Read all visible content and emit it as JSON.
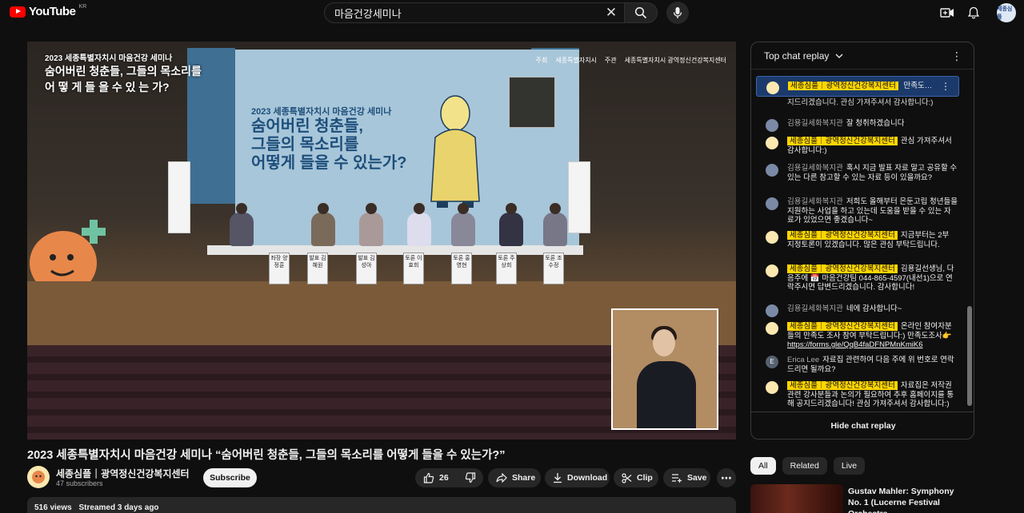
{
  "header": {
    "logo_text": "YouTube",
    "country": "KR",
    "search_value": "마음건강세미나",
    "avatar_text": "세종심플"
  },
  "video": {
    "overlay_line1": "2023 세종특별자치시 마음건강 세미나",
    "overlay_line2": "숨어버린 청춘들, 그들의 목소리를",
    "overlay_line3": "어 떻 게  들 을  수  있 는 가?",
    "sponsor1_role": "주최",
    "sponsor1_name": "세종특별자치시",
    "sponsor2_role": "주관",
    "sponsor2_name": "세종특별자치시 광역정신건강복지센터",
    "screen_sub": "2023 세종특별자치시 마음건강 세미나",
    "screen_l1": "숨어버린 청춘들,",
    "screen_l2": "그들의 목소리를",
    "screen_l3": "어떻게 들을 수 있는가?",
    "nameplates": [
      "좌장 양정훈",
      "발표 김혜원",
      "발표 김성아",
      "토론 이효희",
      "토론 홍영현",
      "토론 주상희",
      "토론 조수정"
    ]
  },
  "title": "2023 세종특별자치시 마음건강 세미나 “숨어버린 청춘들, 그들의 목소리를 어떻게 들을 수 있는가?”",
  "channel": {
    "name": "세종심플｜광역정신건강복지센터",
    "subscribers": "47 subscribers",
    "subscribe_label": "Subscribe"
  },
  "actions": {
    "likes": "26",
    "share": "Share",
    "download": "Download",
    "clip": "Clip",
    "save": "Save"
  },
  "description": {
    "views": "516 views",
    "streamed": "Streamed 3 days ago"
  },
  "chat": {
    "header": "Top chat replay",
    "pinned_author": "세종심플｜광역정신건강복지센터",
    "pinned_text": "만족도…",
    "top_fragment": "강사분들과 논의가 필요하여 추후 홈페이지를 통해 공지드리겠습니다. 관심 가져주셔서 감사합니다:)",
    "messages": [
      {
        "author": "김용길세화복지관",
        "text": "잘 청취하겠습니다",
        "owner": false
      },
      {
        "author": "세종심플｜광역정신건강복지센터",
        "text": "관심 가져주셔서 감사합니다:)",
        "owner": true
      },
      {
        "author": "김용길세화복지관",
        "text": "혹시 지금 발표 자료 말고 공유할 수 있는 다른 참고할 수 있는 자료 등이 있을까요?",
        "owner": false
      },
      {
        "author": "김용길세화복지관",
        "text": "저희도 올해부터 은둔고립 청년들을 지원하는 사업을 하고 있는데 도움을 받을 수 있는 자료가 있었으면 좋겠습니다~",
        "owner": false
      },
      {
        "author": "세종심플｜광역정신건강복지센터",
        "text": "지금부터는 2부 지정토론이 있겠습니다. 많은 관심 부탁드립니다.",
        "owner": true
      },
      {
        "author": "세종심플｜광역정신건강복지센터",
        "text": "김용길선생님, 다음주에 📅 마음건강팀 044-865-4597(내선1)으로 연락주시면 답변드리겠습니다. 감사합니다!",
        "owner": true
      },
      {
        "author": "김용길세화복지관",
        "text": "네에 감사합니다~",
        "owner": false
      },
      {
        "author": "세종심플｜광역정신건강복지센터",
        "text": "온라인 참여자분들의 만족도 조사 참여 부탁드립니다:) 만족도조사👉",
        "link": "https://forms.gle/QqB4faDFNPMnKmiK6",
        "owner": true
      },
      {
        "author": "Erica Lee",
        "text": "자료집 관련하여 다음 주에 위 번호로 연락 드리면 될까요?",
        "owner": false
      },
      {
        "author": "세종심플｜광역정신건강복지센터",
        "text": "자료집은 저작권 관련 강사분들과 논의가 필요하여 추후 홈페이지를 통해 공지드리겠습니다! 관심 가져주셔서 감사합니다:)",
        "owner": true
      }
    ],
    "hide_label": "Hide chat replay"
  },
  "chips": [
    "All",
    "Related",
    "Live"
  ],
  "related": {
    "title": "Gustav Mahler: Symphony No. 1 (Lucerne Festival Orchestra,…"
  },
  "colors": {
    "owner_badge": "#ffd600",
    "accent_red": "#ff0000",
    "pinned_bg": "#1b3a6b"
  }
}
